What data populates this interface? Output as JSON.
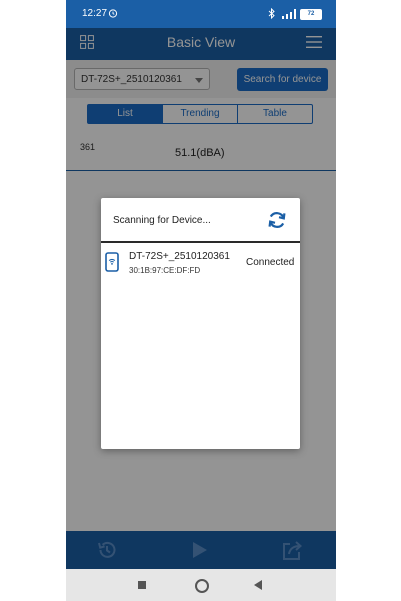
{
  "status_bar": {
    "time": "12:27",
    "battery": "72"
  },
  "header": {
    "title": "Basic View"
  },
  "device_row": {
    "selected_device": "DT-72S+_2510120361",
    "search_button_label": "Search for device"
  },
  "tabs": [
    {
      "label": "List",
      "active": true
    },
    {
      "label": "Trending",
      "active": false
    },
    {
      "label": "Table",
      "active": false
    }
  ],
  "reading": {
    "id": "361",
    "value": "51.1(dBA)"
  },
  "dialog": {
    "title": "Scanning for Device...",
    "devices": [
      {
        "name": "DT-72S+_2510120361",
        "mac": "30:1B:97:CE:DF:FD",
        "status": "Connected"
      }
    ]
  },
  "colors": {
    "primary": "#1b5fa6",
    "accent": "#1b6cc6",
    "overlay": "rgba(0,0,0,0.42)"
  },
  "icons": {
    "header_left": "grid-icon",
    "header_right": "menu-icon",
    "dialog_action": "refresh-icon",
    "device": "phone-wifi-icon",
    "bottom_left": "history-icon",
    "bottom_center": "play-icon",
    "bottom_right": "share-icon"
  }
}
